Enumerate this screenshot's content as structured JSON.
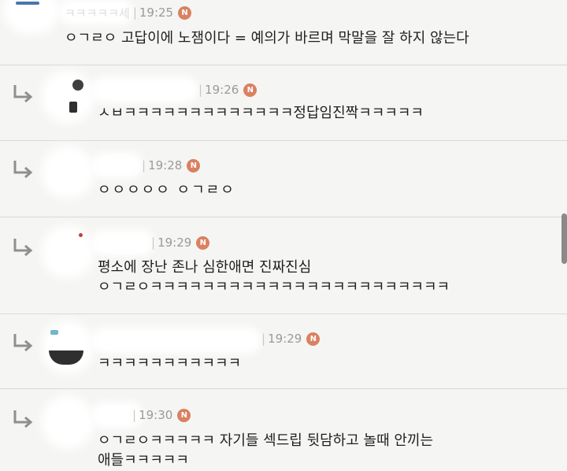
{
  "comments": [
    {
      "name_tail": "ㅋㅋㅋㅋㅋ세",
      "time": "19:25",
      "badge": "N",
      "lines": [
        "ㅇㄱㄹㅇ 고답이에 노잼이다 = 예의가 바르며 막말을 잘 하지 않는다"
      ]
    },
    {
      "name_tail": "",
      "time": "19:26",
      "badge": "N",
      "lines": [
        "ㅅㅂㅋㅋㅋㅋㅋㅋㅋㅋㅋㅋㅋㅋㅋ정답임진짝ㅋㅋㅋㅋㅋ"
      ]
    },
    {
      "name_tail": "",
      "time": "19:28",
      "badge": "N",
      "lines": [
        "ㅇㅇㅇㅇㅇ ㅇㄱㄹㅇ"
      ]
    },
    {
      "name_tail": "",
      "time": "19:29",
      "badge": "N",
      "lines": [
        "평소에 장난 존나 심한애면 진짜진심",
        "ㅇㄱㄹㅇㅋㅋㅋㅋㅋㅋㅋㅋㅋㅋㅋㅋㅋㅋㅋㅋㅋㅋㅋㅋㅋㅋㅋ"
      ]
    },
    {
      "name_tail": "",
      "time": "19:29",
      "badge": "N",
      "lines": [
        "ㅋㅋㅋㅋㅋㅋㅋㅋㅋㅋㅋ"
      ]
    },
    {
      "name_tail": "",
      "time": "19:30",
      "badge": "N",
      "lines": [
        "ㅇㄱㄹㅇㅋㅋㅋㅋㅋ 자기들 섹드립 뒷담하고 놀때 안끼는",
        "애들ㅋㅋㅋㅋㅋ"
      ]
    }
  ],
  "colors": {
    "background": "#f5f5f3",
    "divider": "#d9d9d6",
    "badge": "#d98161",
    "meta_text": "#9a9a9a"
  },
  "icons": {
    "reply": "reply-arrow-icon",
    "new": "new-badge-icon"
  }
}
